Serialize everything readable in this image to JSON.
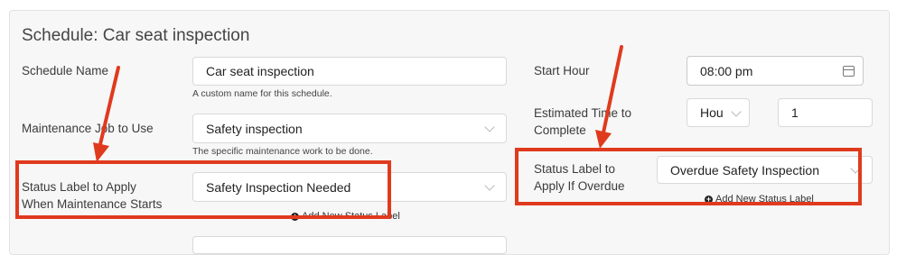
{
  "title": "Schedule: Car seat inspection",
  "schedule_name": {
    "label": "Schedule Name",
    "value": "Car seat inspection",
    "help": "A custom name for this schedule."
  },
  "maintenance_job": {
    "label": "Maintenance Job to Use",
    "value": "Safety inspection",
    "help": "The specific maintenance work to be done."
  },
  "status_start": {
    "label_line1": "Status Label to Apply",
    "label_line2": "When Maintenance Starts",
    "value": "Safety Inspection Needed",
    "add_link": "Add New Status Label"
  },
  "start_hour": {
    "label": "Start Hour",
    "value": "08:00 pm"
  },
  "estimated_time": {
    "label_line1": "Estimated Time to",
    "label_line2": "Complete",
    "unit": "Hou",
    "amount": "1"
  },
  "status_overdue": {
    "label_line1": "Status Label to",
    "label_line2": "Apply If Overdue",
    "value": "Overdue Safety Inspection",
    "add_link": "Add New Status Label"
  },
  "annotation_color": "#e03a1e"
}
